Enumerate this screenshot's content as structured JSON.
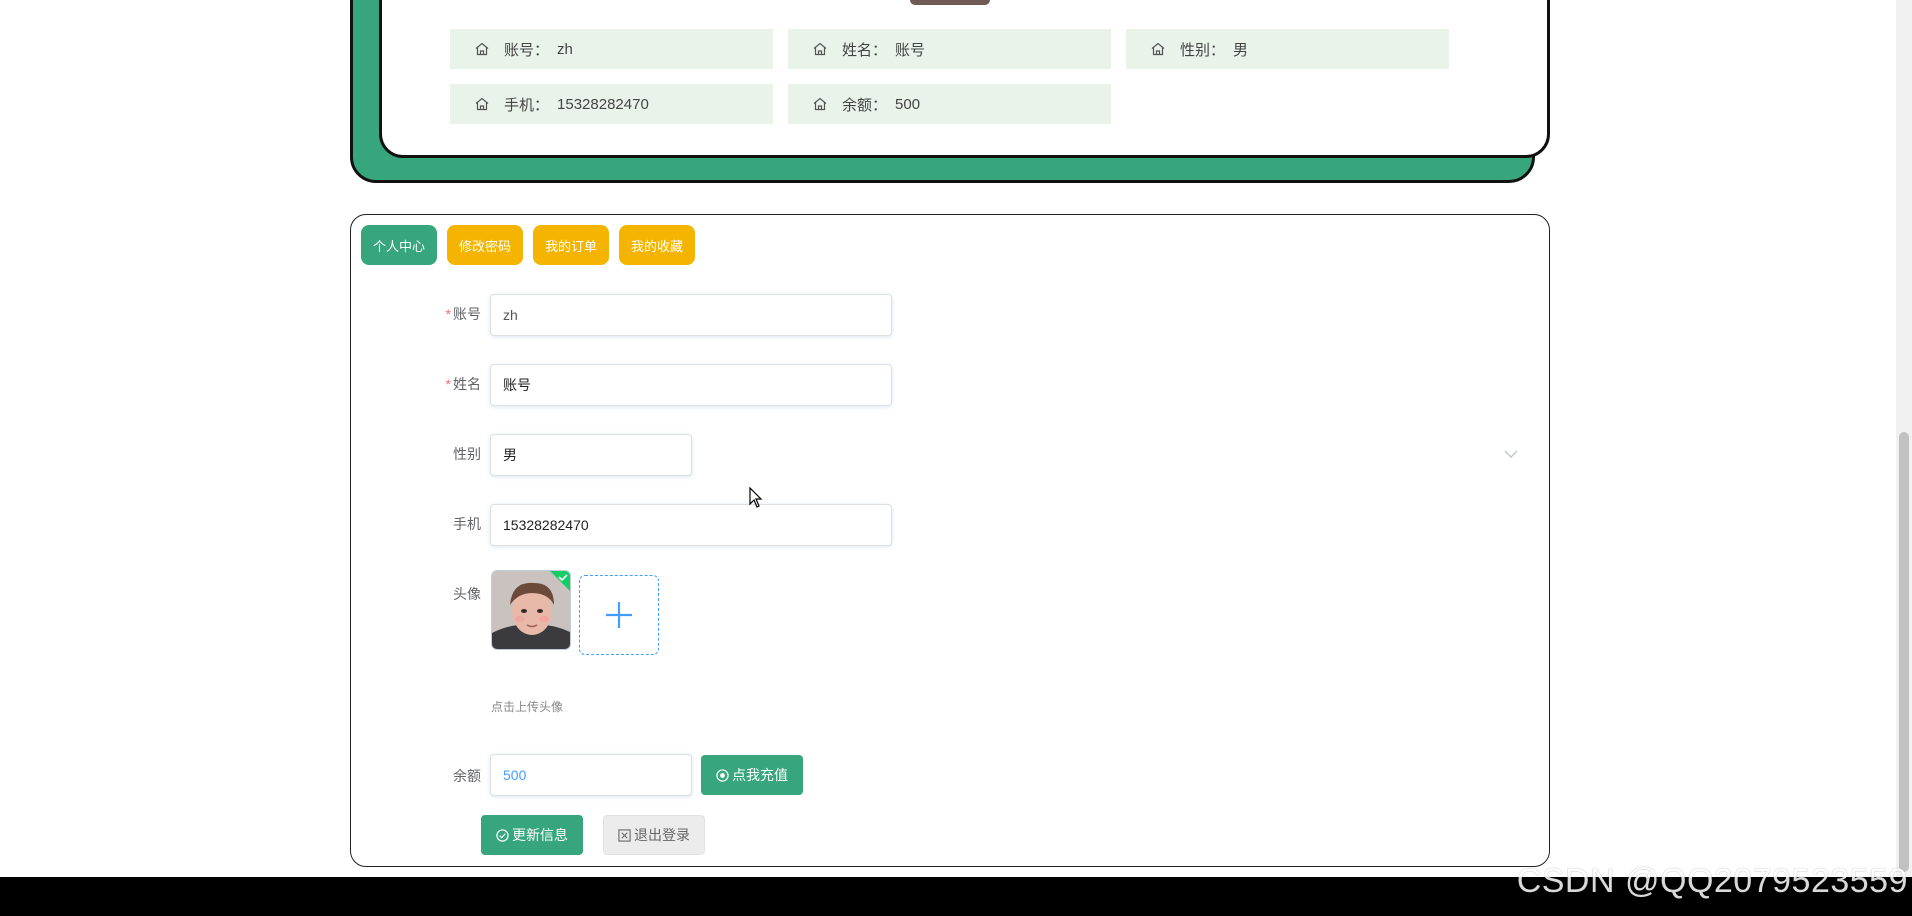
{
  "profile": {
    "items": [
      {
        "label": "账号：",
        "value": "zh"
      },
      {
        "label": "姓名：",
        "value": "账号"
      },
      {
        "label": "性别：",
        "value": "男"
      },
      {
        "label": "手机：",
        "value": "15328282470"
      },
      {
        "label": "余额：",
        "value": "500"
      }
    ]
  },
  "tabs": [
    {
      "label": "个人中心",
      "active": true
    },
    {
      "label": "修改密码",
      "active": false
    },
    {
      "label": "我的订单",
      "active": false
    },
    {
      "label": "我的收藏",
      "active": false
    }
  ],
  "form": {
    "account": {
      "label": "账号",
      "value": "zh",
      "required": true
    },
    "name": {
      "label": "姓名",
      "value": "账号",
      "required": true
    },
    "gender": {
      "label": "性别",
      "value": "男"
    },
    "phone": {
      "label": "手机",
      "value": "15328282470"
    },
    "avatar": {
      "label": "头像",
      "hint": "点击上传头像"
    },
    "balance": {
      "label": "余额",
      "value": "500",
      "recharge_label": "点我充值"
    }
  },
  "actions": {
    "update_label": "更新信息",
    "logout_label": "退出登录"
  },
  "watermark": "CSDN @QQ2079523559",
  "colors": {
    "primary_green": "#37a67c",
    "tab_yellow": "#f4b400",
    "info_bg": "#e9f3ea",
    "link_blue": "#409eff",
    "required_red": "#f56c6c"
  }
}
